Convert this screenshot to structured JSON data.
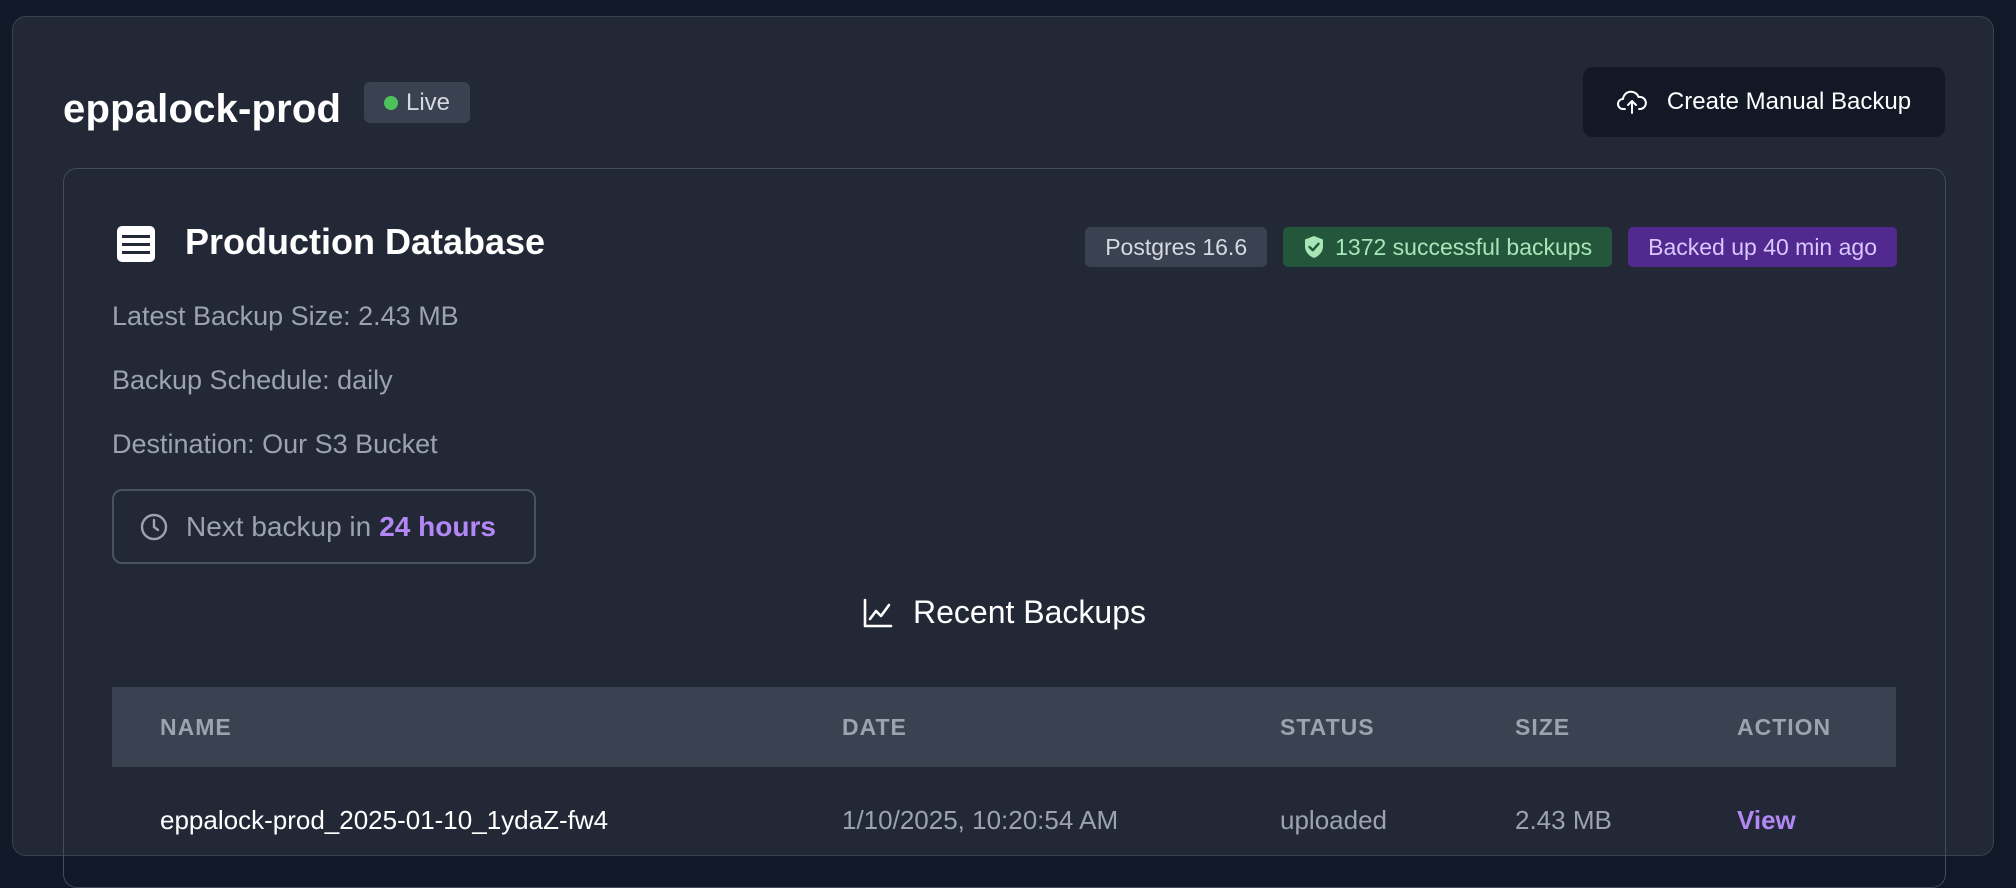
{
  "header": {
    "title": "eppalock-prod",
    "live_label": "Live",
    "create_button_label": "Create Manual Backup"
  },
  "database": {
    "title": "Production Database",
    "badges": {
      "version": "Postgres 16.6",
      "success": "1372 successful backups",
      "backed_up": "Backed up 40 min ago"
    },
    "info": {
      "latest_size": "Latest Backup Size: 2.43 MB",
      "schedule": "Backup Schedule: daily",
      "destination": "Destination: Our S3 Bucket"
    },
    "next_backup": {
      "prefix": "Next backup in",
      "value": "24 hours"
    }
  },
  "recent_backups": {
    "title": "Recent Backups",
    "columns": [
      "NAME",
      "DATE",
      "STATUS",
      "SIZE",
      "ACTION"
    ],
    "rows": [
      {
        "name": "eppalock-prod_2025-01-10_1ydaZ-fw4",
        "date": "1/10/2025, 10:20:54 AM",
        "status": "uploaded",
        "size": "2.43 MB",
        "action": "View"
      }
    ]
  },
  "colors": {
    "accent": "#b388f5",
    "live": "#4cc15c",
    "success_bg": "#23563a",
    "backed_bg": "#522a8f"
  },
  "icons": [
    "cloud-upload-icon",
    "database-icon",
    "shield-check-icon",
    "clock-icon",
    "chart-line-icon"
  ]
}
